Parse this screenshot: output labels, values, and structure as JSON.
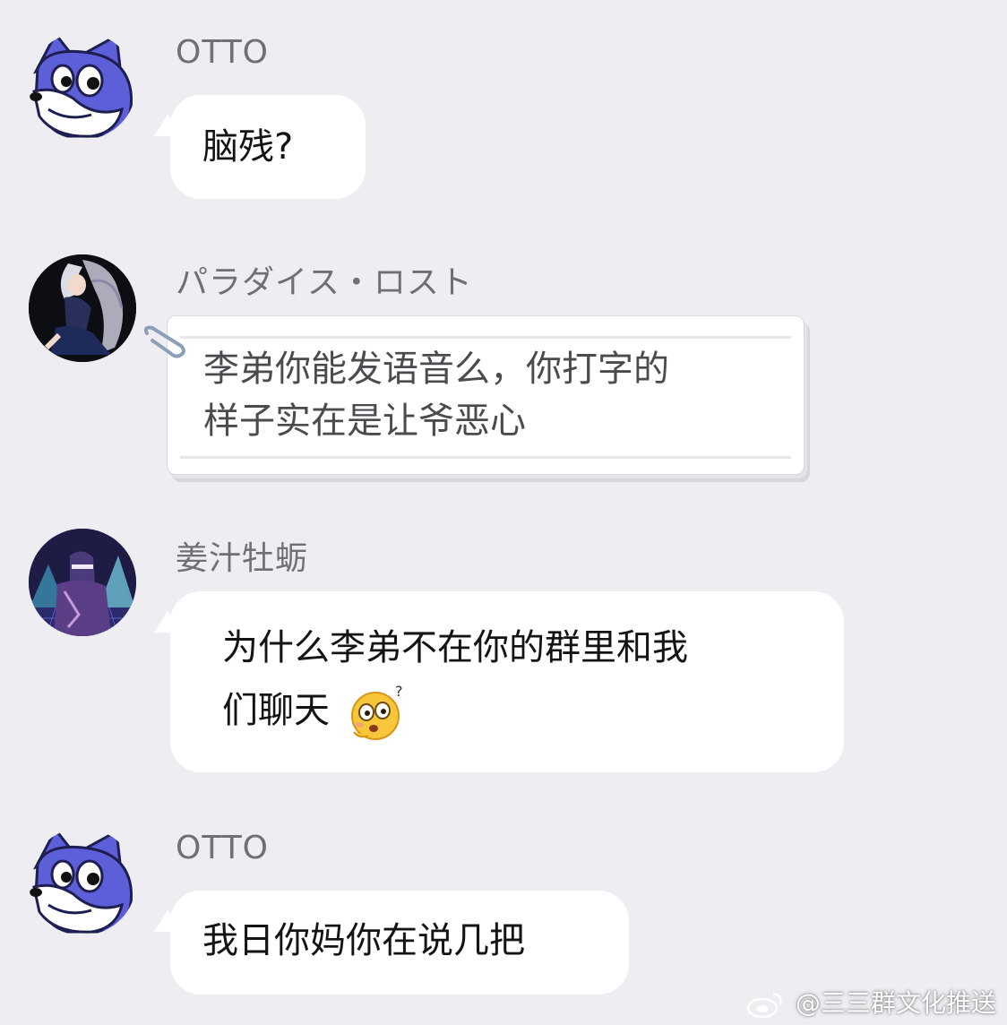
{
  "messages": [
    {
      "sender": "OTTO",
      "avatar_icon": "blue-fox-avatar",
      "text": "脑残?"
    },
    {
      "sender": "パラダイス・ロスト",
      "avatar_icon": "anime-character-avatar",
      "style": "note-paper",
      "text_line1": "李弟你能发语音么，你打字的",
      "text_line2": "样子实在是让爷恶心"
    },
    {
      "sender": "姜汁牡蛎",
      "avatar_icon": "cyber-figure-avatar",
      "text_line1": "为什么李弟不在你的群里和我",
      "text_line2": "们聊天",
      "emoji_icon": "confused-face-emoji"
    },
    {
      "sender": "OTTO",
      "avatar_icon": "blue-fox-avatar",
      "text": "我日你妈你在说几把"
    }
  ],
  "watermark": {
    "icon": "weibo-icon",
    "text": "@三三群文化推送"
  },
  "colors": {
    "background": "#ededf2",
    "bubble": "#ffffff",
    "sender_text": "#6f6f74",
    "fox_blue": "#5c5fd8"
  }
}
